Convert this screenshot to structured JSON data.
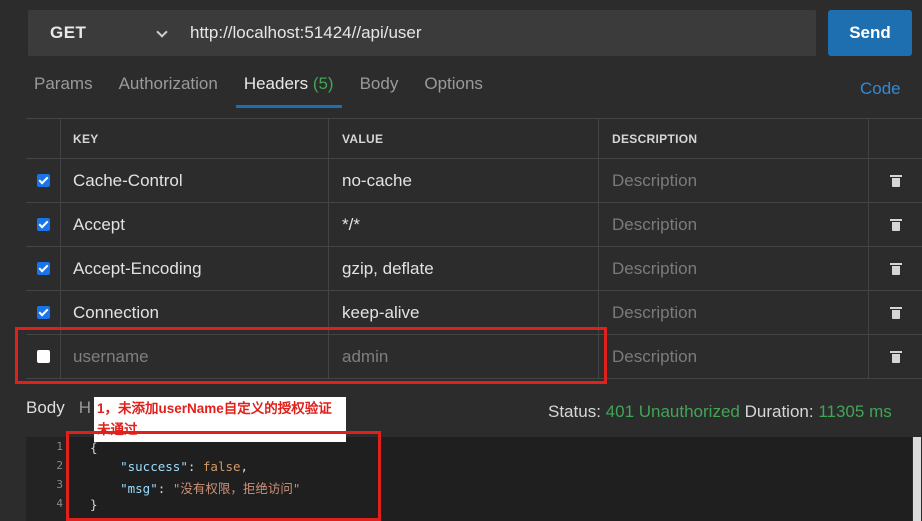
{
  "request": {
    "method": "GET",
    "url": "http://localhost:51424//api/user",
    "send_label": "Send"
  },
  "tabs": [
    {
      "label": "Params"
    },
    {
      "label": "Authorization"
    },
    {
      "label": "Headers",
      "count": "(5)"
    },
    {
      "label": "Body"
    },
    {
      "label": "Options"
    }
  ],
  "code_link": "Code",
  "headers_table": {
    "columns": [
      "KEY",
      "VALUE",
      "DESCRIPTION"
    ],
    "rows": [
      {
        "checked": true,
        "key": "Cache-Control",
        "value": "no-cache",
        "description": "Description"
      },
      {
        "checked": true,
        "key": "Accept",
        "value": "*/*",
        "description": "Description"
      },
      {
        "checked": true,
        "key": "Accept-Encoding",
        "value": "gzip, deflate",
        "description": "Description"
      },
      {
        "checked": true,
        "key": "Connection",
        "value": "keep-alive",
        "description": "Description"
      },
      {
        "checked": false,
        "key": "username",
        "value": "admin",
        "description": "Description"
      }
    ]
  },
  "response": {
    "tab_body": "Body",
    "tab_headers": "H",
    "status_label": "Status:",
    "status_value": "401 Unauthorized",
    "duration_label": "Duration:",
    "duration_value": "11305 ms",
    "annotation": "1，未添加userName自定义的授权验证未通过",
    "line_numbers": [
      "1",
      "2",
      "3",
      "4"
    ],
    "code": {
      "open": "{",
      "success_key": "\"success\"",
      "success_val": "false",
      "msg_key": "\"msg\"",
      "msg_val": "\"没有权限，拒绝访问\"",
      "close": "}"
    }
  },
  "colors": {
    "accent": "#1e6faf",
    "status_green": "#41a556",
    "annotation_red": "#e0201b"
  }
}
